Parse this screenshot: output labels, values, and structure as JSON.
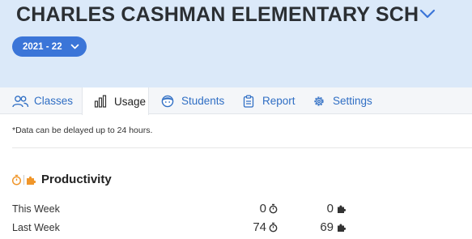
{
  "header": {
    "school_name": "CHARLES CASHMAN ELEMENTARY SCH",
    "school_year": "2021 - 22"
  },
  "tabs": [
    {
      "label": "Classes",
      "icon": "users-icon"
    },
    {
      "label": "Usage",
      "icon": "bar-chart-icon",
      "active": true
    },
    {
      "label": "Students",
      "icon": "student-face-icon"
    },
    {
      "label": "Report",
      "icon": "clipboard-icon"
    },
    {
      "label": "Settings",
      "icon": "gear-icon"
    }
  ],
  "note": "*Data can be delayed up to 24 hours.",
  "productivity": {
    "title": "Productivity",
    "rows": [
      {
        "label": "This Week",
        "time": "0",
        "puzzles": "0"
      },
      {
        "label": "Last Week",
        "time": "74",
        "puzzles": "69"
      }
    ]
  },
  "colors": {
    "header_bg": "#dbe9f9",
    "accent_blue": "#3b75d8",
    "tab_link": "#2f6ec4",
    "orange": "#f0962a"
  }
}
